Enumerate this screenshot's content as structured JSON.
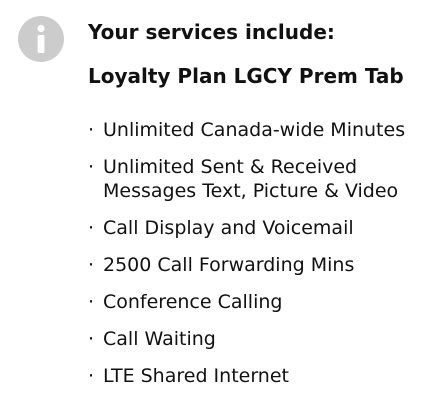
{
  "icons": {
    "info": "info-icon"
  },
  "colors": {
    "icon_fill": "#cccccc",
    "text": "#111111",
    "background": "#ffffff"
  },
  "heading": "Your services include:",
  "plan_name": "Loyalty Plan LGCY Prem Tab",
  "bullet_glyph": "·",
  "services": [
    "Unlimited Canada-wide Minutes",
    "Unlimited Sent & Received Messages Text, Picture & Video",
    "Call Display and Voicemail",
    "2500 Call Forwarding Mins",
    "Conference Calling",
    "Call Waiting",
    "LTE Shared Internet"
  ]
}
